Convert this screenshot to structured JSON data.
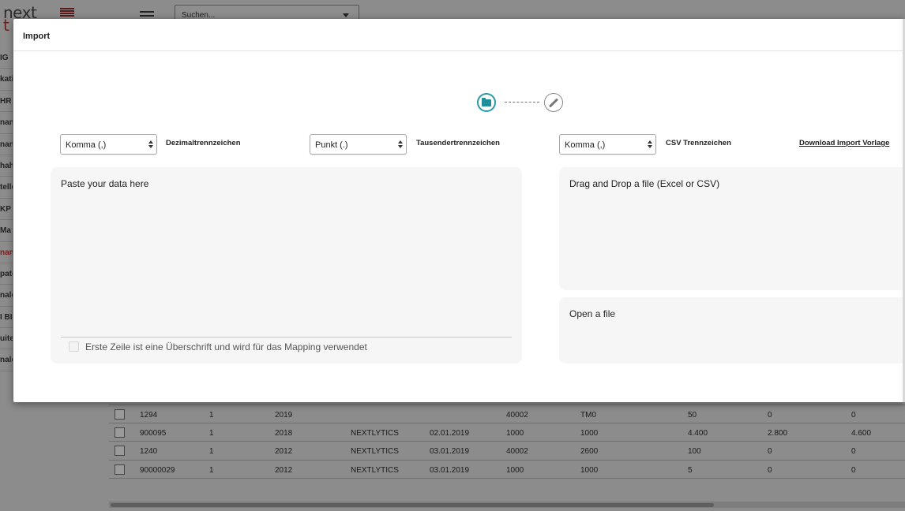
{
  "background": {
    "logo_text": "next",
    "logo_subtext": "t",
    "search_placeholder": "Suchen...",
    "sidebar_items": [
      "IG",
      "katic",
      "HR",
      "nan",
      "nan",
      "hahn",
      "telle",
      "KP -",
      "Ma",
      "nan",
      "pate",
      "nale",
      "I BI",
      "uite",
      "nale"
    ],
    "table_rows": [
      [
        "1294",
        "1",
        "2019",
        "",
        "",
        "40002",
        "TM0",
        "50",
        "0",
        "0"
      ],
      [
        "900095",
        "1",
        "2018",
        "NEXTLYTICS",
        "02.01.2019",
        "1000",
        "1000",
        "4.400",
        "2.800",
        "4.600"
      ],
      [
        "1240",
        "1",
        "2012",
        "NEXTLYTICS",
        "03.01.2019",
        "40002",
        "2600",
        "100",
        "0",
        "0"
      ],
      [
        "90000029",
        "1",
        "2012",
        "NEXTLYTICS",
        "03.01.2019",
        "1000",
        "1000",
        "5",
        "0",
        "0"
      ]
    ]
  },
  "modal": {
    "title": "Import",
    "steps": [
      {
        "icon": "folder-icon",
        "active": true
      },
      {
        "icon": "pencil-icon",
        "active": false
      }
    ],
    "decimal_select": {
      "value": "Komma (,)",
      "label": "Dezimaltrennzeichen"
    },
    "thousands_select": {
      "value": "Punkt (.)",
      "label": "Tausendertrennzeichen"
    },
    "csv_select": {
      "value": "Komma (,)",
      "label": "CSV Trennzeichen"
    },
    "download_link": "Download Import Vorlage",
    "paste_panel": {
      "placeholder": "Paste your data here",
      "checkbox_label": "Erste Zeile ist eine Überschrift und wird für das Mapping verwendet",
      "checkbox_checked": false
    },
    "drop_panel": {
      "text": "Drag and Drop a file (Excel or CSV)"
    },
    "open_panel": {
      "text": "Open a file"
    }
  },
  "colors": {
    "accent": "#2a9aa4",
    "overlay": "#8c8c8c",
    "panel_bg": "#f6f6f6"
  }
}
